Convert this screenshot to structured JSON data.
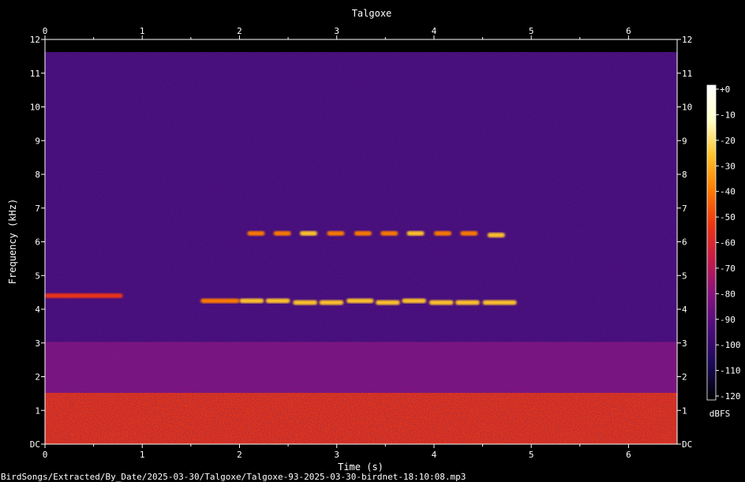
{
  "chart_data": {
    "type": "heatmap",
    "subtype": "spectrogram",
    "title": "Talgoxe",
    "xlabel": "Time (s)",
    "ylabel": "Frequency (kHz)",
    "xlim": [
      0,
      6.5
    ],
    "ylim": [
      0,
      12
    ],
    "x_ticks": [
      "0",
      "1",
      "2",
      "3",
      "4",
      "5",
      "6"
    ],
    "y_ticks": [
      "DC",
      "1",
      "2",
      "3",
      "4",
      "5",
      "6",
      "7",
      "8",
      "9",
      "10",
      "11",
      "12"
    ],
    "colorbar": {
      "label": "dBFS",
      "range": [
        -120,
        0
      ],
      "ticks": [
        "+0",
        "-10",
        "-20",
        "-30",
        "-40",
        "-50",
        "-60",
        "-70",
        "-80",
        "-90",
        "-100",
        "-110",
        "-120"
      ],
      "colors": [
        "#000000",
        "#1a0a55",
        "#4a0b7a",
        "#85127f",
        "#c41a4a",
        "#ee3412",
        "#fb7a03",
        "#fec32a",
        "#ffffc8",
        "#ffffff"
      ]
    },
    "background_noise": {
      "levels": [
        {
          "from_khz": 0,
          "to_khz": 1.5,
          "dbfs": -60
        },
        {
          "from_khz": 1.5,
          "to_khz": 3,
          "dbfs": -75
        },
        {
          "from_khz": 3,
          "to_khz": 11.5,
          "dbfs": -90
        }
      ]
    },
    "calls": [
      {
        "t": 0.0,
        "duration": 0.8,
        "freq_khz": 4.4,
        "dbfs": -55
      },
      {
        "t": 1.6,
        "duration": 0.4,
        "freq_khz": 4.25,
        "dbfs": -45
      },
      {
        "t": 2.08,
        "duration": 0.18,
        "freq_khz": 6.25,
        "dbfs": -40
      },
      {
        "t": 2.35,
        "duration": 0.18,
        "freq_khz": 6.25,
        "dbfs": -35
      },
      {
        "t": 2.62,
        "duration": 0.18,
        "freq_khz": 6.25,
        "dbfs": -32
      },
      {
        "t": 2.9,
        "duration": 0.18,
        "freq_khz": 6.25,
        "dbfs": -35
      },
      {
        "t": 3.18,
        "duration": 0.18,
        "freq_khz": 6.25,
        "dbfs": -38
      },
      {
        "t": 3.45,
        "duration": 0.18,
        "freq_khz": 6.25,
        "dbfs": -35
      },
      {
        "t": 3.72,
        "duration": 0.18,
        "freq_khz": 6.25,
        "dbfs": -30
      },
      {
        "t": 4.0,
        "duration": 0.18,
        "freq_khz": 6.25,
        "dbfs": -40
      },
      {
        "t": 4.27,
        "duration": 0.18,
        "freq_khz": 6.25,
        "dbfs": -38
      },
      {
        "t": 4.55,
        "duration": 0.18,
        "freq_khz": 6.2,
        "dbfs": -30
      },
      {
        "t": 2.0,
        "duration": 0.25,
        "freq_khz": 4.25,
        "dbfs": -30
      },
      {
        "t": 2.27,
        "duration": 0.25,
        "freq_khz": 4.25,
        "dbfs": -28
      },
      {
        "t": 2.55,
        "duration": 0.25,
        "freq_khz": 4.2,
        "dbfs": -30
      },
      {
        "t": 2.82,
        "duration": 0.25,
        "freq_khz": 4.2,
        "dbfs": -28
      },
      {
        "t": 3.1,
        "duration": 0.28,
        "freq_khz": 4.25,
        "dbfs": -25
      },
      {
        "t": 3.4,
        "duration": 0.25,
        "freq_khz": 4.2,
        "dbfs": -30
      },
      {
        "t": 3.67,
        "duration": 0.25,
        "freq_khz": 4.25,
        "dbfs": -25
      },
      {
        "t": 3.95,
        "duration": 0.25,
        "freq_khz": 4.2,
        "dbfs": -28
      },
      {
        "t": 4.22,
        "duration": 0.25,
        "freq_khz": 4.2,
        "dbfs": -30
      },
      {
        "t": 4.5,
        "duration": 0.35,
        "freq_khz": 4.2,
        "dbfs": -32
      }
    ],
    "grid": false
  },
  "footer": {
    "path": "BirdSongs/Extracted/By_Date/2025-03-30/Talgoxe/Talgoxe-93-2025-03-30-birdnet-18:10:08.mp3"
  }
}
